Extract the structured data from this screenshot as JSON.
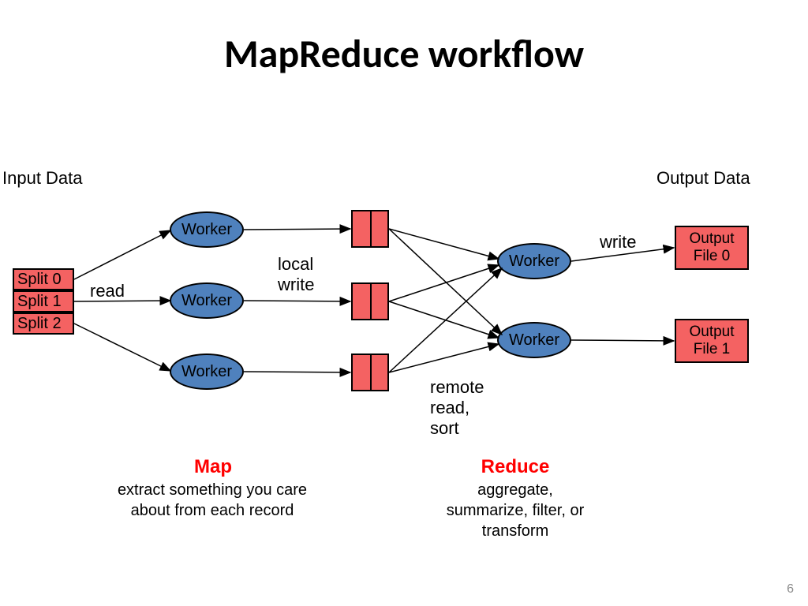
{
  "title": "MapReduce workflow",
  "labels": {
    "input": "Input Data",
    "output": "Output Data",
    "read": "read",
    "local_write_l1": "local",
    "local_write_l2": "write",
    "remote_sort_l1": "remote",
    "remote_sort_l2": "read,",
    "remote_sort_l3": "sort",
    "write": "write"
  },
  "splits": [
    "Split 0",
    "Split 1",
    "Split 2"
  ],
  "worker": "Worker",
  "outputs": [
    "Output File 0",
    "Output File 1"
  ],
  "phases": {
    "map_title": "Map",
    "map_desc": "extract something you care about from each record",
    "reduce_title": "Reduce",
    "reduce_desc": "aggregate, summarize, filter, or transform"
  },
  "page": "6"
}
